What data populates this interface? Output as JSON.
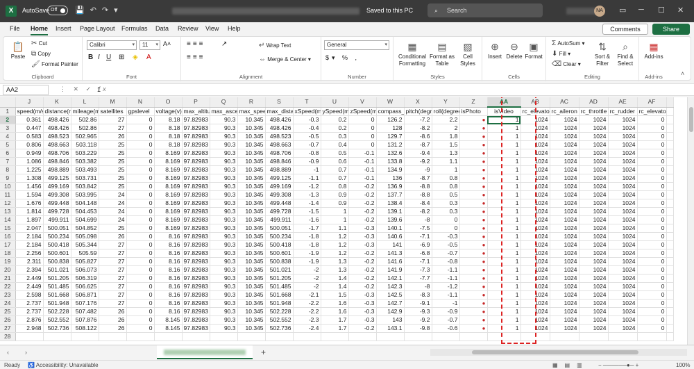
{
  "titlebar": {
    "autosave_label": "AutoSave",
    "autosave_state": "Off",
    "saved_status": "Saved to this PC",
    "search_placeholder": "Search",
    "avatar_initials": "NA"
  },
  "menu": {
    "tabs": [
      "File",
      "Home",
      "Insert",
      "Page Layout",
      "Formulas",
      "Data",
      "Review",
      "View",
      "Help"
    ],
    "active": "Home",
    "comments_label": "Comments",
    "share_label": "Share"
  },
  "ribbon": {
    "clipboard": {
      "paste": "Paste",
      "cut": "Cut",
      "copy": "Copy",
      "format_painter": "Format Painter",
      "label": "Clipboard"
    },
    "font": {
      "name": "Calibri",
      "size": "11",
      "bold": "B",
      "italic": "I",
      "underline": "U",
      "label": "Font"
    },
    "alignment": {
      "wrap": "Wrap Text",
      "merge": "Merge & Center",
      "label": "Alignment"
    },
    "number": {
      "format": "General",
      "label": "Number"
    },
    "styles": {
      "conditional": "Conditional Formatting",
      "format_table": "Format as Table",
      "cell_styles": "Cell Styles",
      "label": "Styles"
    },
    "cells": {
      "insert": "Insert",
      "delete": "Delete",
      "format": "Format",
      "label": "Cells"
    },
    "editing": {
      "autosum": "AutoSum",
      "fill": "Fill",
      "clear": "Clear",
      "sort": "Sort & Filter",
      "find": "Find & Select",
      "label": "Editing"
    },
    "addins": {
      "addins": "Add-ins",
      "label": "Add-ins"
    }
  },
  "formula_bar": {
    "name_box": "AA2",
    "content": "1"
  },
  "columns": [
    "J",
    "K",
    "L",
    "M",
    "N",
    "O",
    "P",
    "Q",
    "R",
    "S",
    "T",
    "U",
    "V",
    "W",
    "X",
    "Y",
    "Z",
    "AA",
    "AB",
    "AC",
    "AD",
    "AE",
    "AF"
  ],
  "headers": [
    "speed(m/s",
    "distance(n",
    "mileage(m",
    "satellites",
    "gpslevel",
    "voltage(v)",
    "max_altitu",
    "max_ascer",
    "max_spee",
    "max_dista",
    "xSpeed(m/",
    "ySpeed(m/",
    "zSpeed(m/",
    "compass_l",
    "pitch(degr",
    "roll(degree",
    "isPhoto",
    "isVideo",
    "rc_elevato",
    "rc_aileron",
    "rc_throttle",
    "rc_rudder",
    "rc_elevato"
  ],
  "rows": [
    [
      "0.361",
      "498.426",
      "502.86",
      "27",
      "0",
      "8.18",
      "97.82983",
      "90.3",
      "10.345",
      "498.426",
      "-0.3",
      "0.2",
      "0",
      "126.2",
      "-7.2",
      "2.2",
      "",
      "1",
      "1024",
      "1024",
      "1024",
      "1024",
      "0"
    ],
    [
      "0.447",
      "498.426",
      "502.86",
      "27",
      "0",
      "8.18",
      "97.82983",
      "90.3",
      "10.345",
      "498.426",
      "-0.4",
      "0.2",
      "0",
      "128",
      "-8.2",
      "2",
      "",
      "1",
      "1024",
      "1024",
      "1024",
      "1024",
      "0"
    ],
    [
      "0.583",
      "498.523",
      "502.965",
      "26",
      "0",
      "8.18",
      "97.82983",
      "90.3",
      "10.345",
      "498.523",
      "-0.5",
      "0.3",
      "0",
      "129.7",
      "-8.6",
      "1.8",
      "",
      "1",
      "1024",
      "1024",
      "1024",
      "1024",
      "0"
    ],
    [
      "0.806",
      "498.663",
      "503.118",
      "25",
      "0",
      "8.18",
      "97.82983",
      "90.3",
      "10.345",
      "498.663",
      "-0.7",
      "0.4",
      "0",
      "131.2",
      "-8.7",
      "1.5",
      "",
      "1",
      "1024",
      "1024",
      "1024",
      "1024",
      "0"
    ],
    [
      "0.949",
      "498.706",
      "503.229",
      "25",
      "0",
      "8.169",
      "97.82983",
      "90.3",
      "10.345",
      "498.706",
      "-0.8",
      "0.5",
      "-0.1",
      "132.6",
      "-9.4",
      "1.3",
      "",
      "1",
      "1024",
      "1024",
      "1024",
      "1024",
      "0"
    ],
    [
      "1.086",
      "498.846",
      "503.382",
      "25",
      "0",
      "8.169",
      "97.82983",
      "90.3",
      "10.345",
      "498.846",
      "-0.9",
      "0.6",
      "-0.1",
      "133.8",
      "-9.2",
      "1.1",
      "",
      "1",
      "1024",
      "1024",
      "1024",
      "1024",
      "0"
    ],
    [
      "1.225",
      "498.889",
      "503.493",
      "25",
      "0",
      "8.169",
      "97.82983",
      "90.3",
      "10.345",
      "498.889",
      "-1",
      "0.7",
      "-0.1",
      "134.9",
      "-9",
      "1",
      "",
      "1",
      "1024",
      "1024",
      "1024",
      "1024",
      "0"
    ],
    [
      "1.308",
      "499.125",
      "503.731",
      "25",
      "0",
      "8.169",
      "97.82983",
      "90.3",
      "10.345",
      "499.125",
      "-1.1",
      "0.7",
      "-0.1",
      "136",
      "-8.7",
      "0.8",
      "",
      "1",
      "1024",
      "1024",
      "1024",
      "1024",
      "0"
    ],
    [
      "1.456",
      "499.169",
      "503.842",
      "25",
      "0",
      "8.169",
      "97.82983",
      "90.3",
      "10.345",
      "499.169",
      "-1.2",
      "0.8",
      "-0.2",
      "136.9",
      "-8.8",
      "0.8",
      "",
      "1",
      "1024",
      "1024",
      "1024",
      "1024",
      "0"
    ],
    [
      "1.594",
      "499.308",
      "503.995",
      "24",
      "0",
      "8.169",
      "97.82983",
      "90.3",
      "10.345",
      "499.308",
      "-1.3",
      "0.9",
      "-0.2",
      "137.7",
      "-8.8",
      "0.5",
      "",
      "1",
      "1024",
      "1024",
      "1024",
      "1024",
      "0"
    ],
    [
      "1.676",
      "499.448",
      "504.148",
      "24",
      "0",
      "8.169",
      "97.82983",
      "90.3",
      "10.345",
      "499.448",
      "-1.4",
      "0.9",
      "-0.2",
      "138.4",
      "-8.4",
      "0.3",
      "",
      "1",
      "1024",
      "1024",
      "1024",
      "1024",
      "0"
    ],
    [
      "1.814",
      "499.728",
      "504.453",
      "24",
      "0",
      "8.169",
      "97.82983",
      "90.3",
      "10.345",
      "499.728",
      "-1.5",
      "1",
      "-0.2",
      "139.1",
      "-8.2",
      "0.3",
      "",
      "1",
      "1024",
      "1024",
      "1024",
      "1024",
      "0"
    ],
    [
      "1.897",
      "499.911",
      "504.699",
      "24",
      "0",
      "8.169",
      "97.82983",
      "90.3",
      "10.345",
      "499.911",
      "-1.6",
      "1",
      "-0.2",
      "139.6",
      "-8",
      "0",
      "",
      "1",
      "1024",
      "1024",
      "1024",
      "1024",
      "0"
    ],
    [
      "2.047",
      "500.051",
      "504.852",
      "25",
      "0",
      "8.169",
      "97.82983",
      "90.3",
      "10.345",
      "500.051",
      "-1.7",
      "1.1",
      "-0.3",
      "140.1",
      "-7.5",
      "0",
      "",
      "1",
      "1024",
      "1024",
      "1024",
      "1024",
      "0"
    ],
    [
      "2.184",
      "500.234",
      "505.098",
      "26",
      "0",
      "8.16",
      "97.82983",
      "90.3",
      "10.345",
      "500.234",
      "-1.8",
      "1.2",
      "-0.3",
      "140.6",
      "-7.1",
      "-0.3",
      "",
      "1",
      "1024",
      "1024",
      "1024",
      "1024",
      "0"
    ],
    [
      "2.184",
      "500.418",
      "505.344",
      "27",
      "0",
      "8.16",
      "97.82983",
      "90.3",
      "10.345",
      "500.418",
      "-1.8",
      "1.2",
      "-0.3",
      "141",
      "-6.9",
      "-0.5",
      "",
      "1",
      "1024",
      "1024",
      "1024",
      "1024",
      "0"
    ],
    [
      "2.256",
      "500.601",
      "505.59",
      "27",
      "0",
      "8.16",
      "97.82983",
      "90.3",
      "10.345",
      "500.601",
      "-1.9",
      "1.2",
      "-0.2",
      "141.3",
      "-6.8",
      "-0.7",
      "",
      "1",
      "1024",
      "1024",
      "1024",
      "1024",
      "0"
    ],
    [
      "2.311",
      "500.838",
      "505.827",
      "27",
      "0",
      "8.16",
      "97.82983",
      "90.3",
      "10.345",
      "500.838",
      "-1.9",
      "1.3",
      "-0.2",
      "141.6",
      "-7.1",
      "-0.8",
      "",
      "1",
      "1024",
      "1024",
      "1024",
      "1024",
      "0"
    ],
    [
      "2.394",
      "501.021",
      "506.073",
      "27",
      "0",
      "8.16",
      "97.82983",
      "90.3",
      "10.345",
      "501.021",
      "-2",
      "1.3",
      "-0.2",
      "141.9",
      "-7.3",
      "-1.1",
      "",
      "1",
      "1024",
      "1024",
      "1024",
      "1024",
      "0"
    ],
    [
      "2.449",
      "501.205",
      "506.319",
      "27",
      "0",
      "8.16",
      "97.82983",
      "90.3",
      "10.345",
      "501.205",
      "-2",
      "1.4",
      "-0.2",
      "142.1",
      "-7.7",
      "-1.1",
      "",
      "1",
      "1024",
      "1024",
      "1024",
      "1024",
      "0"
    ],
    [
      "2.449",
      "501.485",
      "506.625",
      "27",
      "0",
      "8.16",
      "97.82983",
      "90.3",
      "10.345",
      "501.485",
      "-2",
      "1.4",
      "-0.2",
      "142.3",
      "-8",
      "-1.2",
      "",
      "1",
      "1024",
      "1024",
      "1024",
      "1024",
      "0"
    ],
    [
      "2.598",
      "501.668",
      "506.871",
      "27",
      "0",
      "8.16",
      "97.82983",
      "90.3",
      "10.345",
      "501.668",
      "-2.1",
      "1.5",
      "-0.3",
      "142.5",
      "-8.3",
      "-1.1",
      "",
      "1",
      "1024",
      "1024",
      "1024",
      "1024",
      "0"
    ],
    [
      "2.737",
      "501.948",
      "507.176",
      "27",
      "0",
      "8.16",
      "97.82983",
      "90.3",
      "10.345",
      "501.948",
      "-2.2",
      "1.6",
      "-0.3",
      "142.7",
      "-9.1",
      "-1",
      "",
      "1",
      "1024",
      "1024",
      "1024",
      "1024",
      "0"
    ],
    [
      "2.737",
      "502.228",
      "507.482",
      "26",
      "0",
      "8.16",
      "97.82983",
      "90.3",
      "10.345",
      "502.228",
      "-2.2",
      "1.6",
      "-0.3",
      "142.9",
      "-9.3",
      "-0.9",
      "",
      "1",
      "1024",
      "1024",
      "1024",
      "1024",
      "0"
    ],
    [
      "2.876",
      "502.552",
      "507.876",
      "26",
      "0",
      "8.145",
      "97.82983",
      "90.3",
      "10.345",
      "502.552",
      "-2.3",
      "1.7",
      "-0.3",
      "143",
      "-9.2",
      "-0.7",
      "",
      "1",
      "1024",
      "1024",
      "1024",
      "1024",
      "0"
    ],
    [
      "2.948",
      "502.736",
      "508.122",
      "26",
      "0",
      "8.145",
      "97.82983",
      "90.3",
      "10.345",
      "502.736",
      "-2.4",
      "1.7",
      "-0.2",
      "143.1",
      "-9.8",
      "-0.6",
      "",
      "1",
      "1024",
      "1024",
      "1024",
      "1024",
      "0"
    ]
  ],
  "status": {
    "ready": "Ready",
    "accessibility": "Accessibility: Unavailable",
    "zoom": "100%"
  },
  "colors": {
    "accent": "#1d6f42",
    "highlight": "#dd2222"
  }
}
